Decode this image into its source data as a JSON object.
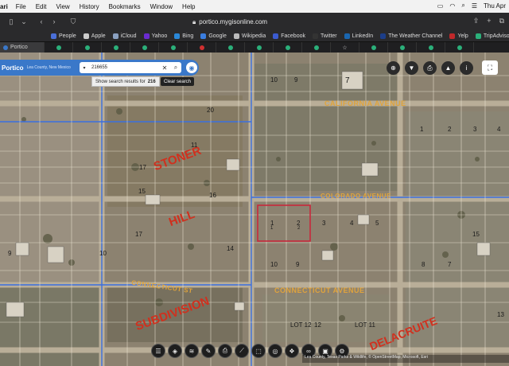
{
  "menubar": {
    "app_name": "ari",
    "items": [
      "File",
      "Edit",
      "View",
      "History",
      "Bookmarks",
      "Window",
      "Help"
    ],
    "clock": "Thu Apr"
  },
  "browser": {
    "url": "portico.mygisonline.com",
    "favorites": [
      {
        "label": "People",
        "color": "#4a6fd8"
      },
      {
        "label": "Apple",
        "color": "#cccccc"
      },
      {
        "label": "iCloud",
        "color": "#8aa0c0"
      },
      {
        "label": "Yahoo",
        "color": "#6a2bd0"
      },
      {
        "label": "Bing",
        "color": "#2a88d8"
      },
      {
        "label": "Google",
        "color": "#3a7ee0"
      },
      {
        "label": "Wikipedia",
        "color": "#bbbbbb"
      },
      {
        "label": "Facebook",
        "color": "#3b5bd0"
      },
      {
        "label": "Twitter",
        "color": "#333333"
      },
      {
        "label": "LinkedIn",
        "color": "#1a66b0"
      },
      {
        "label": "The Weather Channel",
        "color": "#1c3e8a"
      },
      {
        "label": "Yelp",
        "color": "#c0282a"
      },
      {
        "label": "TripAdvisor",
        "color": "#2bb07a"
      }
    ],
    "active_tab": "Portico"
  },
  "portico": {
    "logo": "Portico",
    "county": "Lea County, New Mexico",
    "search_value": "216655",
    "hint_prefix": "Show search results for",
    "hint_value": "216",
    "tooltip": "Clear search"
  },
  "map": {
    "streets": {
      "california": "CALIFORNIA AVENUE",
      "colorado": "COLORADO AVENUE",
      "connecticut": "CONNECTICUT AVENUE",
      "connecticut_st": "CONNECTICUT ST"
    },
    "subdivision_words": [
      "STONER",
      "HILL",
      "SUBDIVISION",
      "DELACRUITE"
    ],
    "lot_numbers": [
      "10",
      "9",
      "7",
      "1",
      "2",
      "3",
      "4",
      "17",
      "20",
      "11",
      "1",
      "2",
      "3",
      "4",
      "5",
      "15",
      "16",
      "15",
      "17",
      "10",
      "9",
      "8",
      "7",
      "14",
      "12",
      "13",
      "LOT 12",
      "LOT 11",
      "10",
      "9",
      "1",
      "2"
    ],
    "attribution": "Lea County, Texas Parks & Wildlife, © OpenStreetMap, Microsoft, Esri"
  },
  "colors": {
    "accent": "#3a78c9",
    "street_label": "#e0a43c",
    "subdivision": "#d0301e",
    "selected_parcel": "#c8283c"
  }
}
